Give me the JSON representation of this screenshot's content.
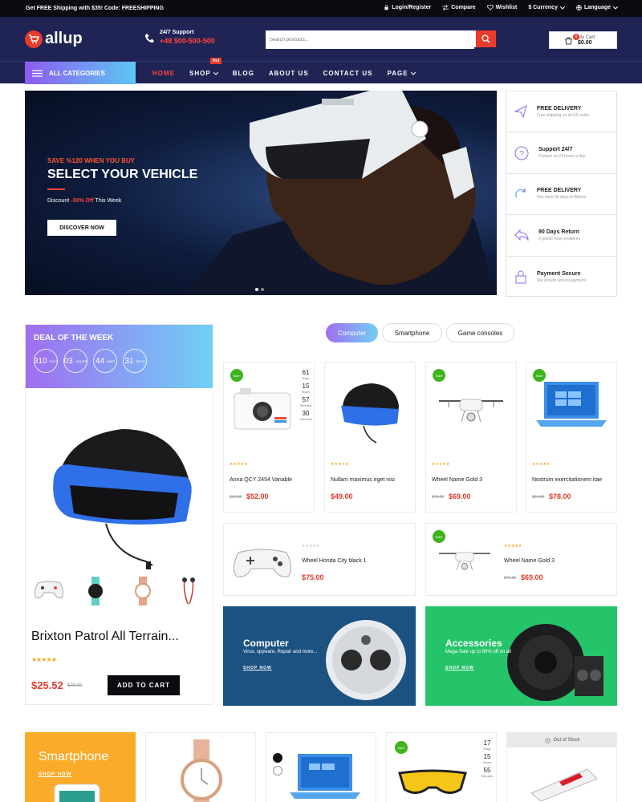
{
  "topbar": {
    "promo": "Get FREE Shipping with $35! Code: FREESHIPPING",
    "links": [
      "Login/Register",
      "Compare",
      "Wishlist",
      "$ Currency",
      "Language"
    ]
  },
  "header": {
    "logo": "allup",
    "support_label": "24/7 Support",
    "support_phone": "+48 500-500-500",
    "search_placeholder": "Search products...",
    "cart_label": "My Cart:",
    "cart_total": "$0.00",
    "cart_count": "0"
  },
  "nav": {
    "categories": "ALL CATEGORIES",
    "items": [
      "HOME",
      "SHOP",
      "BLOG",
      "ABOUT US",
      "CONTACT US",
      "PAGE"
    ],
    "hot_badge": "Hot"
  },
  "hero": {
    "subtitle": "SAVE %120 WHEN YOU BUY",
    "title": "SELECT YOUR VEHICLE",
    "discount_prefix": "Discount ",
    "discount_pct": "-30% Off",
    "discount_suffix": " This Week",
    "cta": "DISCOVER NOW"
  },
  "features": [
    {
      "title": "FREE DELIVERY",
      "sub": "Free shipping on all US order",
      "icon": "paper-plane-icon"
    },
    {
      "title": "Support 24/7",
      "sub": "Contact us 24 hours a day",
      "icon": "question-icon"
    },
    {
      "title": "FREE DELIVERY",
      "sub": "You have 30 days to Return",
      "icon": "refresh-icon"
    },
    {
      "title": "90 Days Return",
      "sub": "If goods have problems",
      "icon": "return-arrow-icon"
    },
    {
      "title": "Payment Secure",
      "sub": "We ensure secure payment",
      "icon": "lock-icon"
    }
  ],
  "deal": {
    "title": "DEAL OF THE WEEK",
    "timer": [
      {
        "v": "310",
        "u": "DAYS"
      },
      {
        "v": "03",
        "u": "HOURS"
      },
      {
        "v": "44",
        "u": "MINS"
      },
      {
        "v": "31",
        "u": "SECS"
      }
    ],
    "product": "Brixton Patrol All Terrain...",
    "stars": "★★★★★",
    "price": "$25.52",
    "old_price": "$29.00",
    "add_to_cart": "ADD TO CART"
  },
  "tabs": [
    "Computer",
    "Smartphone",
    "Game consoles"
  ],
  "products": [
    {
      "title": "Anna QCY 2454 Variable",
      "price": "$52.00",
      "old": "$62.00",
      "sale": "Sale!",
      "stars": "★★★★★"
    },
    {
      "title": "Nullam maximus eget nisi",
      "price": "$49.00",
      "old": "",
      "sale": "",
      "stars": "★★★★★"
    },
    {
      "title": "Wheel Name Gold 3",
      "price": "$69.00",
      "old": "$76.00",
      "sale": "Sale!",
      "stars": "★★★★★"
    },
    {
      "title": "Nostrum exercitationem itae",
      "price": "$78.00",
      "old": "$96.00",
      "sale": "Sale!",
      "stars": "★★★★★"
    },
    {
      "title": "Wheel Honda City black 1",
      "price": "$75.00",
      "old": "",
      "sale": "",
      "stars": "★★★★★"
    },
    {
      "title": "Wheel Name Gold 3",
      "price": "$69.00",
      "old": "$76.00",
      "sale": "Sale!",
      "stars": "★★★★★"
    }
  ],
  "card_timer": [
    {
      "v": "61",
      "u": "Days"
    },
    {
      "v": "15",
      "u": "Hours"
    },
    {
      "v": "57",
      "u": "Minutes"
    },
    {
      "v": "30",
      "u": "Seconds"
    }
  ],
  "bottom_timer": [
    {
      "v": "17",
      "u": "Days"
    },
    {
      "v": "15",
      "u": "Hours"
    },
    {
      "v": "55",
      "u": "Minutes"
    }
  ],
  "banners": [
    {
      "title": "Computer",
      "sub": "Virus, spyware, Repair and more...",
      "link": "SHOP NOW"
    },
    {
      "title": "Accessories",
      "sub": "Mega-Sale up to 60% off on all",
      "link": "SHOP NOW"
    }
  ],
  "bottom": {
    "smartphone_title": "Smartphone",
    "smartphone_link": "SHOP NOW",
    "sale": "Sale!",
    "out_of_stock": "Out of Stock"
  },
  "colors": {
    "accent": "#ea3b2c",
    "navy": "#1f2455",
    "sale_green": "#3fb31d"
  }
}
